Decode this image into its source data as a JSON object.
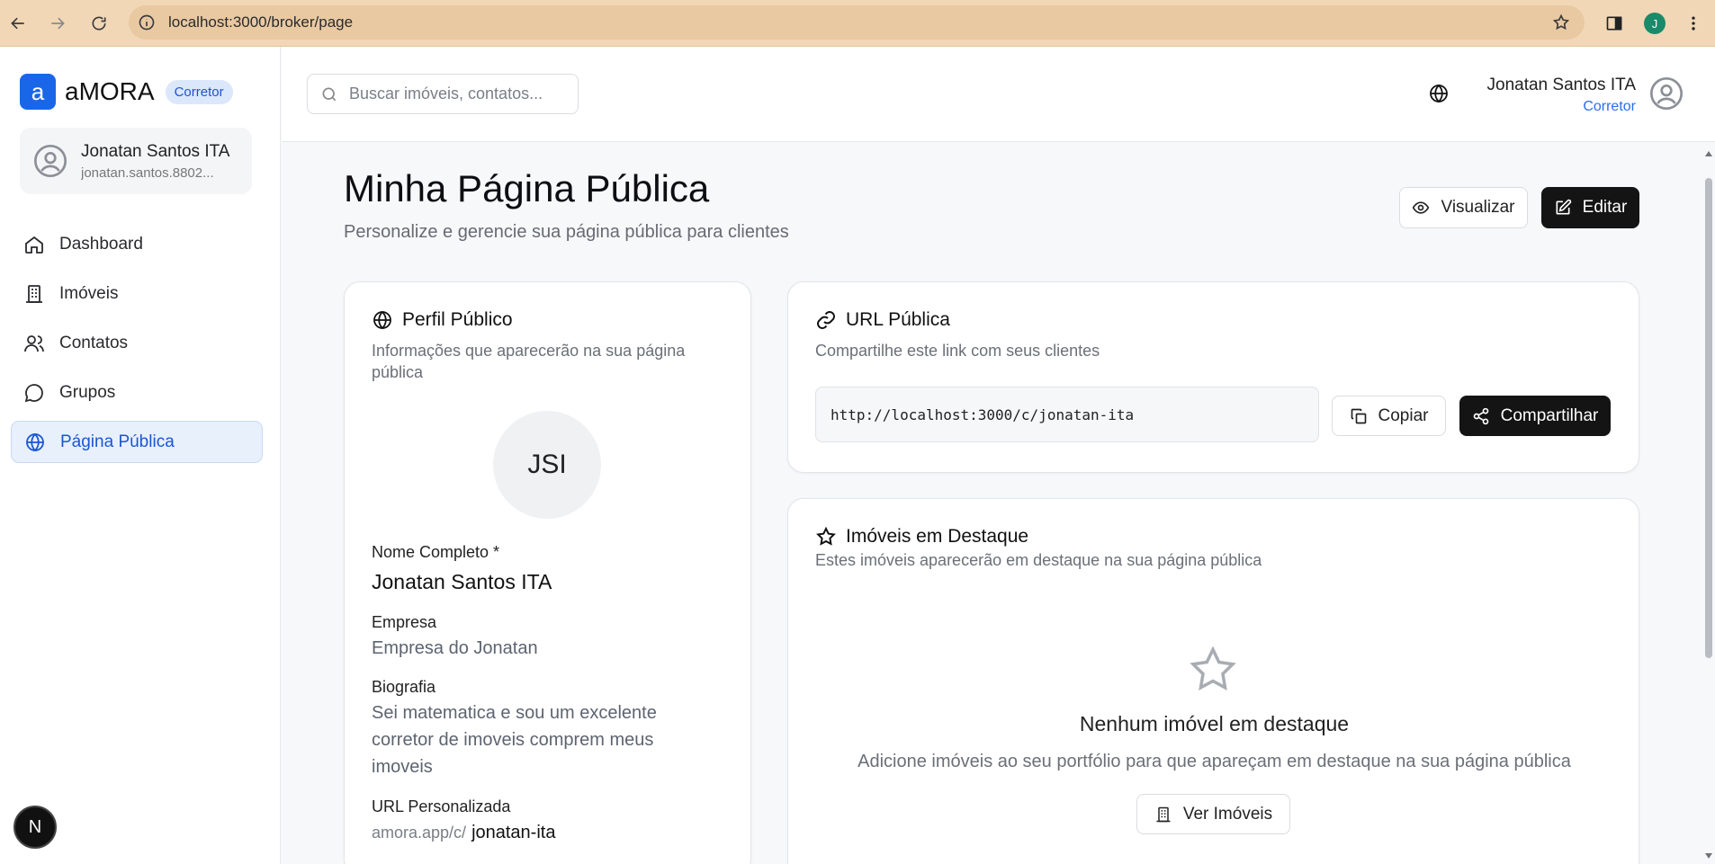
{
  "browser": {
    "url": "localhost:3000/broker/page",
    "profile_initial": "J"
  },
  "sidebar": {
    "brand_logo": "a",
    "brand_name": "aMORA",
    "role_badge": "Corretor",
    "user_name": "Jonatan Santos ITA",
    "user_email": "jonatan.santos.8802...",
    "items": [
      {
        "label": "Dashboard",
        "icon": "home-icon"
      },
      {
        "label": "Imóveis",
        "icon": "building-icon"
      },
      {
        "label": "Contatos",
        "icon": "users-icon"
      },
      {
        "label": "Grupos",
        "icon": "chat-icon"
      },
      {
        "label": "Página Pública",
        "icon": "globe-icon",
        "active": true
      }
    ],
    "dev_badge": "N"
  },
  "header": {
    "search_placeholder": "Buscar imóveis, contatos...",
    "user_name": "Jonatan Santos ITA",
    "user_role": "Corretor"
  },
  "page": {
    "title": "Minha Página Pública",
    "subtitle": "Personalize e gerencie sua página pública para clientes",
    "visualizar_label": "Visualizar",
    "editar_label": "Editar"
  },
  "profile_card": {
    "title": "Perfil Público",
    "description": "Informações que aparecerão na sua página pública",
    "initials": "JSI",
    "name_label": "Nome Completo *",
    "name_value": "Jonatan Santos ITA",
    "company_label": "Empresa",
    "company_value": "Empresa do Jonatan",
    "bio_label": "Biografia",
    "bio_value": "Sei matematica e sou um excelente corretor de imoveis comprem meus imoveis",
    "url_label": "URL Personalizada",
    "url_prefix": "amora.app/c/",
    "url_slug": "jonatan-ita"
  },
  "url_card": {
    "title": "URL Pública",
    "description": "Compartilhe este link com seus clientes",
    "url": "http://localhost:3000/c/jonatan-ita",
    "copy_label": "Copiar",
    "share_label": "Compartilhar"
  },
  "featured_card": {
    "title": "Imóveis em Destaque",
    "description": "Estes imóveis aparecerão em destaque na sua página pública",
    "empty_title": "Nenhum imóvel em destaque",
    "empty_desc": "Adicione imóveis ao seu portfólio para que apareçam em destaque na sua página pública",
    "button_label": "Ver Imóveis"
  },
  "colors": {
    "accent": "#1967e8",
    "chrome": "#f1d7b6",
    "dark_button": "#141414"
  }
}
